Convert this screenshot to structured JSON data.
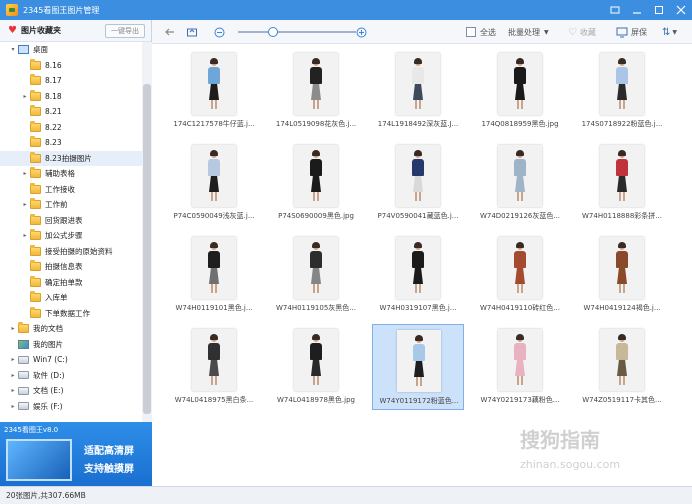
{
  "window": {
    "title": "2345看图王图片管理"
  },
  "sidebar": {
    "header": "图片收藏夹",
    "export_btn": "一键导出",
    "items": [
      {
        "label": "桌面",
        "icon": "desktop",
        "level": 0,
        "arrow": "▾"
      },
      {
        "label": "8.16",
        "icon": "folder",
        "level": 1,
        "arrow": ""
      },
      {
        "label": "8.17",
        "icon": "folder",
        "level": 1,
        "arrow": ""
      },
      {
        "label": "8.18",
        "icon": "folder",
        "level": 1,
        "arrow": "▸"
      },
      {
        "label": "8.21",
        "icon": "folder",
        "level": 1,
        "arrow": ""
      },
      {
        "label": "8.22",
        "icon": "folder",
        "level": 1,
        "arrow": ""
      },
      {
        "label": "8.23",
        "icon": "folder",
        "level": 1,
        "arrow": ""
      },
      {
        "label": "8.23拍摄图片",
        "icon": "folder",
        "level": 1,
        "arrow": "",
        "selected": true
      },
      {
        "label": "辅助表格",
        "icon": "folder",
        "level": 1,
        "arrow": "▸"
      },
      {
        "label": "工作接收",
        "icon": "folder",
        "level": 1,
        "arrow": ""
      },
      {
        "label": "工作前",
        "icon": "folder",
        "level": 1,
        "arrow": "▸"
      },
      {
        "label": "回货跟进表",
        "icon": "folder",
        "level": 1,
        "arrow": ""
      },
      {
        "label": "加公式步骤",
        "icon": "folder",
        "level": 1,
        "arrow": "▸"
      },
      {
        "label": "接受拍摄的原始资料",
        "icon": "folder",
        "level": 1,
        "arrow": ""
      },
      {
        "label": "拍摄信息表",
        "icon": "folder",
        "level": 1,
        "arrow": ""
      },
      {
        "label": "确定拍单款",
        "icon": "folder",
        "level": 1,
        "arrow": ""
      },
      {
        "label": "入库单",
        "icon": "folder",
        "level": 1,
        "arrow": ""
      },
      {
        "label": "下单数据工作",
        "icon": "folder",
        "level": 1,
        "arrow": ""
      },
      {
        "label": "我的文档",
        "icon": "folder",
        "level": 0,
        "arrow": "▸"
      },
      {
        "label": "我的图片",
        "icon": "picture",
        "level": 0,
        "arrow": ""
      },
      {
        "label": "Win7 (C:)",
        "icon": "drive",
        "level": 0,
        "arrow": "▸"
      },
      {
        "label": "软件 (D:)",
        "icon": "drive",
        "level": 0,
        "arrow": "▸"
      },
      {
        "label": "文档 (E:)",
        "icon": "drive",
        "level": 0,
        "arrow": "▸"
      },
      {
        "label": "娱乐 (F:)",
        "icon": "drive",
        "level": 0,
        "arrow": "▸"
      }
    ],
    "ad": {
      "title": "2345看图王v8.0",
      "line1": "适配高清屏",
      "line2": "支持触摸屏"
    }
  },
  "toolbar": {
    "select_all": "全选",
    "batch": "批量处理",
    "favorite": "收藏",
    "fullscreen": "屏保",
    "zoom_level": 0.3
  },
  "images": [
    {
      "name": "174C1217578牛仔蓝.j...",
      "top": "#6fa6d8",
      "bottom": "#1d1d1d"
    },
    {
      "name": "174L0519098花灰色.j...",
      "top": "#222222",
      "bottom": "#8c8c8c"
    },
    {
      "name": "174L1918492深灰蓝.J...",
      "top": "#e8e8e8",
      "bottom": "#3e4a5c"
    },
    {
      "name": "174Q0818959黑色.jpg",
      "top": "#1a1a1a",
      "bottom": "#1a1a1a"
    },
    {
      "name": "174S0718922粉蓝色.j...",
      "top": "#a9c6e6",
      "bottom": "#2b2b2b"
    },
    {
      "name": "P74C0590049浅灰蓝.j...",
      "top": "#b7c9e0",
      "bottom": "#1f1f1f"
    },
    {
      "name": "P74S0690009黑色.jpg",
      "top": "#1b1b1b",
      "bottom": "#1b1b1b"
    },
    {
      "name": "P74V0590041藏蓝色.j...",
      "top": "#253a6a",
      "bottom": "#d9d9d9"
    },
    {
      "name": "W74D0219126灰蓝色...",
      "top": "#9fb3c9",
      "bottom": "#9fb3c9"
    },
    {
      "name": "W74H0118888彩条拼...",
      "top": "#c0333a",
      "bottom": "#2a2a2a"
    },
    {
      "name": "W74H0119101黑色.j...",
      "top": "#1e1e1e",
      "bottom": "#707070"
    },
    {
      "name": "W74H0119105灰黑色...",
      "top": "#2d2d2d",
      "bottom": "#858585"
    },
    {
      "name": "W74H0319107黑色.j...",
      "top": "#1b1b1b",
      "bottom": "#1b1b1b"
    },
    {
      "name": "W74H0419110砖红色...",
      "top": "#a44a2e",
      "bottom": "#a44a2e"
    },
    {
      "name": "W74H0419124褐色.j...",
      "top": "#8a4a2a",
      "bottom": "#8a4a2a"
    },
    {
      "name": "W74L0418975黑白条...",
      "top": "#303030",
      "bottom": "#4a4a4a"
    },
    {
      "name": "W74L0418978黑色.jpg",
      "top": "#1e1e1e",
      "bottom": "#2a2a2a"
    },
    {
      "name": "W74Y0119172粉蓝色...",
      "top": "#a8c8ea",
      "bottom": "#1e1e1e",
      "selected": true
    },
    {
      "name": "W74Y0219173藕粉色...",
      "top": "#e8b2c0",
      "bottom": "#e8b2c0"
    },
    {
      "name": "W74Z0519117卡其色...",
      "top": "#c9b79a",
      "bottom": "#6b5a44"
    }
  ],
  "status": {
    "text": "20张图片,共307.66MB"
  },
  "watermark": {
    "main": "搜狗指南",
    "sub": "zhinan.sogou.com"
  },
  "colors": {
    "titlebar": "#3c8fe0",
    "selection": "#cce1fa",
    "ad": "#1a6fd0"
  }
}
